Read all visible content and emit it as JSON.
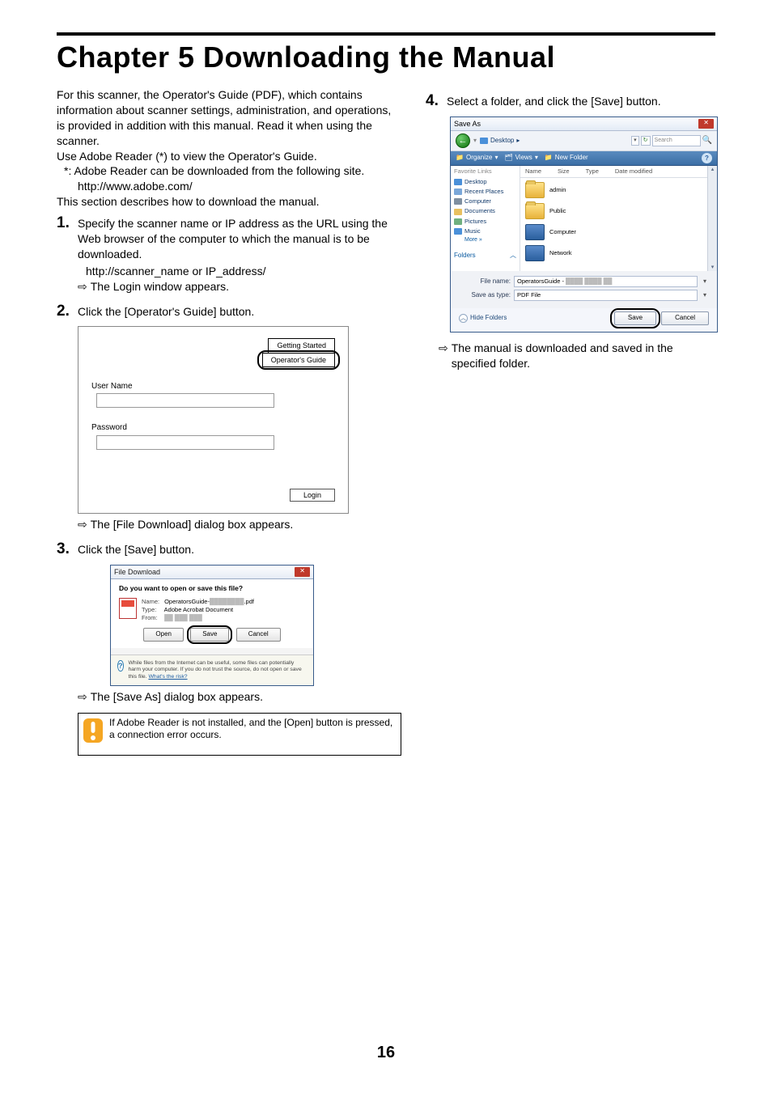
{
  "chapter_title": "Chapter 5   Downloading the Manual",
  "page_number": "16",
  "left_col": {
    "intro1": "For this scanner, the Operator's Guide (PDF), which contains information about scanner settings, administration, and operations, is provided in addition with this manual. Read it when using the scanner.",
    "intro2": "Use Adobe Reader (*) to view the Operator's Guide.",
    "note": "*: Adobe Reader can be downloaded from the following site.",
    "adobe_url": "http://www.adobe.com/",
    "intro3": "This section describes how to download the manual.",
    "steps": [
      {
        "num": "1.",
        "text": "Specify the scanner name or IP address as the URL using the Web browser of the computer to which the manual is to be downloaded.",
        "sub_url": "http://scanner_name or IP_address/",
        "result": "The Login window appears."
      },
      {
        "num": "2.",
        "text": "Click the [Operator's Guide] button.",
        "result": "The [File Download] dialog box appears."
      },
      {
        "num": "3.",
        "text": "Click the [Save] button.",
        "result": "The [Save As] dialog box appears."
      }
    ],
    "warn_text": "If Adobe Reader is not installed, and the [Open] button is pressed, a connection error occurs."
  },
  "right_col": {
    "steps": [
      {
        "num": "4.",
        "text": "Select a folder, and click the [Save] button.",
        "result": "The manual is downloaded and saved in the specified folder."
      }
    ]
  },
  "login_dialog": {
    "btn_getting_started": "Getting Started",
    "btn_operators_guide": "Operator's Guide",
    "label_user": "User Name",
    "label_pass": "Password",
    "btn_login": "Login"
  },
  "file_download_dialog": {
    "title": "File Download",
    "question": "Do you want to open or save this file?",
    "name_label": "Name:",
    "name_value_prefix": "OperatorsGuide-",
    "name_value_suffix": ".pdf",
    "type_label": "Type:",
    "type_value": "Adobe Acrobat Document",
    "from_label": "From:",
    "btn_open": "Open",
    "btn_save": "Save",
    "btn_cancel": "Cancel",
    "warn": "While files from the Internet can be useful, some files can potentially harm your computer. If you do not trust the source, do not open or save this file. ",
    "warn_link": "What's the risk?"
  },
  "save_as_dialog": {
    "title": "Save As",
    "crumb": "Desktop",
    "search_placeholder": "Search",
    "tb_organize": "Organize",
    "tb_views": "Views",
    "tb_newfolder": "New Folder",
    "side_header": "Favorite Links",
    "side": [
      "Desktop",
      "Recent Places",
      "Computer",
      "Documents",
      "Pictures",
      "Music"
    ],
    "side_more": "More »",
    "side_folders": "Folders",
    "cols": [
      "Name",
      "Size",
      "Type",
      "Date modified"
    ],
    "items": [
      "admin",
      "Public",
      "Computer",
      "Network"
    ],
    "filename_label": "File name:",
    "filename_value": "OperatorsGuide -",
    "savetype_label": "Save as type:",
    "savetype_value": "PDF File",
    "hide_folders": "Hide Folders",
    "btn_save": "Save",
    "btn_cancel": "Cancel"
  }
}
